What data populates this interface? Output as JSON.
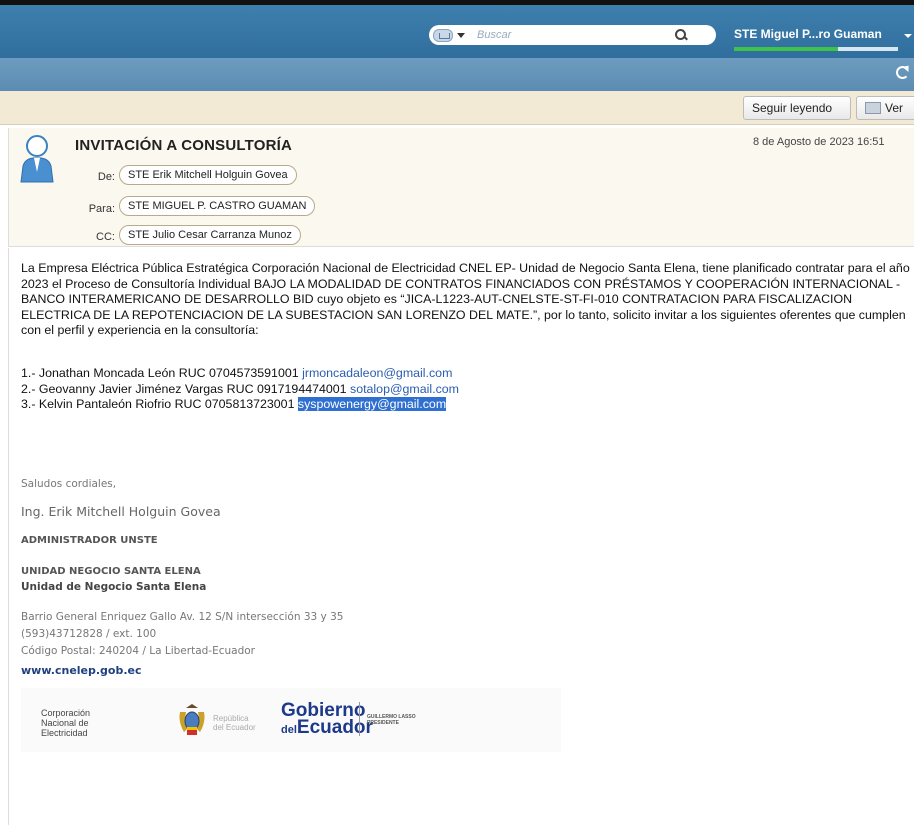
{
  "topbar": {
    "search_placeholder": "Buscar",
    "user_name": "STE Miguel P...ro Guaman"
  },
  "toolbar": {
    "continue_label": "Seguir leyendo",
    "view_label": "Ver"
  },
  "message": {
    "subject": "INVITACIÓN A CONSULTORÍA",
    "date": "8 de Agosto de 2023 16:51",
    "from_label": "De:",
    "from": "STE Erik Mitchell Holguin Govea",
    "to_label": "Para:",
    "to": "STE MIGUEL P. CASTRO GUAMAN",
    "cc_label": "CC:",
    "cc": "STE Julio Cesar Carranza Munoz"
  },
  "body": {
    "paragraph": "La Empresa Eléctrica Pública Estratégica Corporación Nacional de Electricidad CNEL EP- Unidad de Negocio Santa Elena, tiene planificado contratar para el año 2023 el Proceso de Consultoría Individual BAJO LA MODALIDAD DE CONTRATOS FINANCIADOS CON PRÉSTAMOS Y COOPERACIÓN INTERNACIONAL - BANCO INTERAMERICANO DE DESARROLLO BID cuyo objeto es “JICA-L1223-AUT-CNELSTE-ST-FI-010 CONTRATACION PARA FISCALIZACION ELECTRICA DE LA REPOTENCIACION DE LA SUBESTACION SAN LORENZO DEL MATE.”, por lo tanto, solicito invitar a los siguientes oferentes que cumplen con el perfil y experiencia en la consultoría:",
    "list": [
      {
        "text": "1.- Jonathan Moncada León RUC 0704573591001 ",
        "email": "jrmoncadaleon@gmail.com"
      },
      {
        "text": "2.- Geovanny Javier Jiménez Vargas RUC 0917194474001 ",
        "email": "sotalop@gmail.com"
      },
      {
        "text": "3.- Kelvin Pantaleón Riofrio  RUC 0705813723001 ",
        "email": "syspowenergy@gmail.com"
      }
    ]
  },
  "signature": {
    "greeting": "Saludos cordiales,",
    "name": "Ing. Erik Mitchell Holguin Govea",
    "role": "ADMINISTRADOR UNSTE",
    "unit": "UNIDAD NEGOCIO SANTA ELENA",
    "unit2": "Unidad de Negocio Santa Elena",
    "address": "Barrio General Enriquez Gallo Av. 12 S/N intersección 33 y 35",
    "phone": "(593)43712828 / ext. 100",
    "postal": "Código Postal: 240204 / La Libertad-Ecuador",
    "website": "www.cnelep.gob.ec"
  },
  "logos": {
    "cnel_line1": "Corporación",
    "cnel_line2": "Nacional de",
    "cnel_line3": "Electricidad",
    "rep_line1": "República",
    "rep_line2": "del Ecuador",
    "gob_line1": "Gobierno",
    "gob_del": "del",
    "gob_line2": "Ecuador",
    "gl_line1": "GUILLERMO LASSO",
    "gl_line2": "PRESIDENTE"
  },
  "colors": {
    "topbar": "#3f7fae",
    "toolbar": "#f3ead6",
    "header": "#fbf8ef",
    "link": "#2a5db0",
    "selection": "#2f6fcf",
    "progress": "#3ec24a"
  }
}
